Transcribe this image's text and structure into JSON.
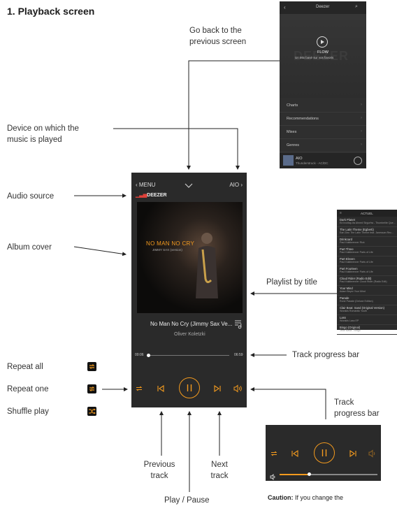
{
  "title": "1. Playback screen",
  "annotations": {
    "go_back": [
      "Go back to the",
      "previous screen"
    ],
    "device": [
      "Device on which the",
      "music is played"
    ],
    "audio_source": "Audio source",
    "album_cover": "Album cover",
    "playlist": "Playlist by title",
    "progress": "Track progress bar",
    "progress2": [
      "Track",
      "progress bar"
    ],
    "repeat_all": "Repeat all",
    "repeat_one": "Repeat one",
    "shuffle": "Shuffle play",
    "previous": [
      "Previous",
      "track"
    ],
    "next": [
      "Next",
      "track"
    ],
    "play_pause": "Play / Pause",
    "caution_bold": "Caution:",
    "caution_text": " If you change the"
  },
  "phone": {
    "menu": "MENU",
    "device": "AIO",
    "source_logo": "DEEZER",
    "cover_title": "NO MAN NO CRY",
    "cover_artist": "JIMMY SAX (version)",
    "track_title": "No Man No Cry (Jimmy Sax Ve...",
    "artist": "Oliver Koletzki",
    "time_elapsed": "00:06",
    "time_total": "06:59",
    "progress": 0.02
  },
  "deezer": {
    "header": "Deezer",
    "flow": "FLOW",
    "flow_sub": "Un Mix basé sur vos favoris",
    "logo": "DEEZER",
    "menu": [
      "Charts",
      "Recommendations",
      "Mixes",
      "Genres"
    ],
    "now_playing_title": "AIO",
    "now_playing_sub": "Thunderstruck - AC/DC"
  },
  "playlist": {
    "header": "ACTUEL",
    "items": [
      [
        "Dark Planet",
        "Ed kvoltap-Ita Ahned Sirgurfra - Thumbelite Que..."
      ],
      [
        "The Latin Theme (Egberti)",
        "Earl Zinc The Latin Theme feat. Janessan Rec..."
      ],
      [
        "Drinkcard",
        "Paul Kalkbrenner Rick"
      ],
      [
        "Part Three",
        "Paul Kalkbrenner Parts of Life"
      ],
      [
        "Part Eleven",
        "Paul Kalkbrenner Parts of Life"
      ],
      [
        "Part Fourteen",
        "Paul Kalkbrenner Parts of Life"
      ],
      [
        "Cloud Rider (Radio Edit)",
        "Paul Kalkbrenner Cloud Rider (Radio Edit)"
      ],
      [
        "Your Mind",
        "Adam Beyer Your Mind"
      ],
      [
        "Parade",
        "Rone Parade (Deluxe Edition)"
      ],
      [
        "Clair Beat: Sand (Original Version)",
        "Worakls Romantic Youth"
      ],
      [
        "Lass",
        "Worakls Lass EP"
      ],
      [
        "Bingo (Original)",
        "Jean Nava - Bingo"
      ]
    ]
  },
  "colors": {
    "accent": "#f39a1e",
    "deezer_red": "#e0413a",
    "screen_bg": "#2a2a2a"
  }
}
